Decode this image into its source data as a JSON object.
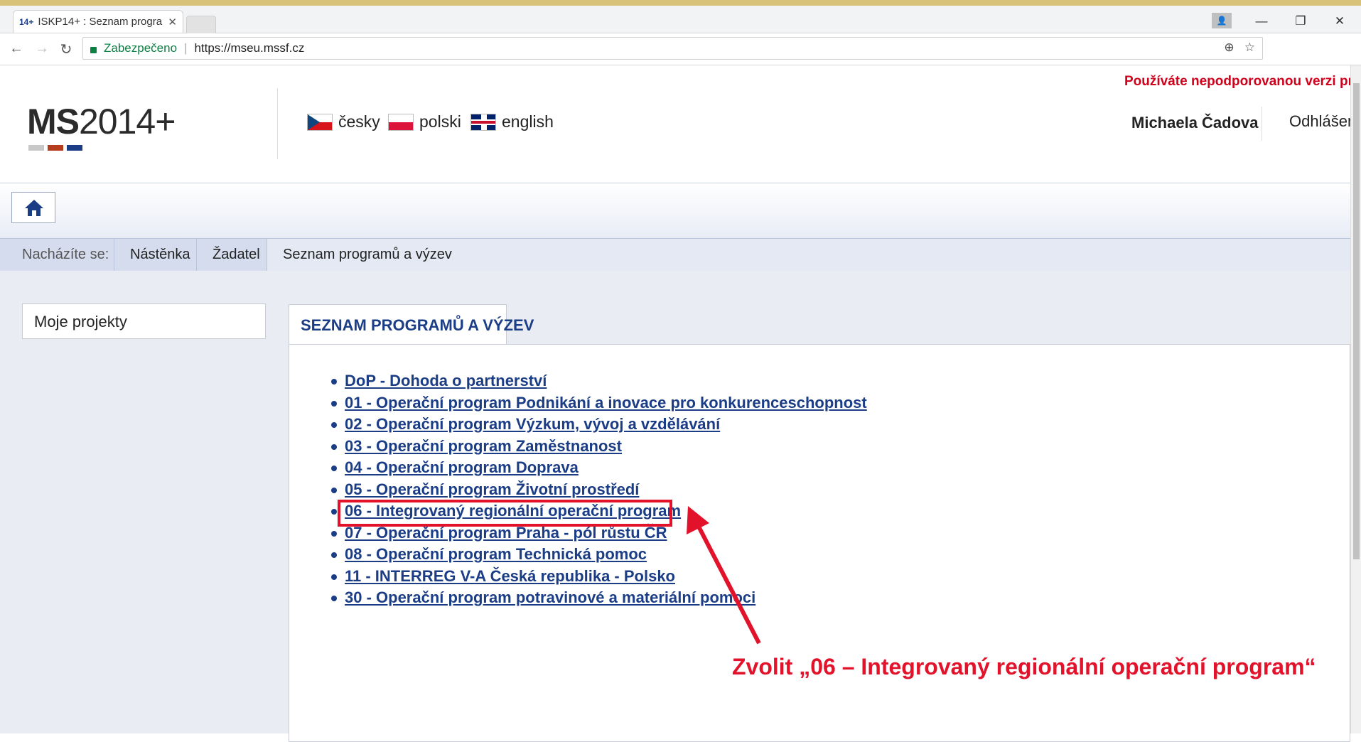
{
  "browser": {
    "tab_title": "ISKP14+ : Seznam progra",
    "tab_favicon": "14+",
    "secure_label": "Zabezpečeno",
    "url": "https://mseu.mssf.cz"
  },
  "header": {
    "logo_bold": "MS",
    "logo_rest": "2014+",
    "languages": [
      {
        "label": "česky",
        "flag": "cz-flag-icon"
      },
      {
        "label": "polski",
        "flag": "pl-flag-icon"
      },
      {
        "label": "english",
        "flag": "uk-flag-icon"
      }
    ],
    "warning": "Používáte nepodporovanou verzi prohlí",
    "user_name": "Michaela Čadova",
    "logout": "Odhlášen"
  },
  "breadcrumb": {
    "label": "Nacházíte se:",
    "items": [
      "Nástěnka",
      "Žadatel",
      "Seznam programů a výzev"
    ]
  },
  "sidebar": {
    "items": [
      {
        "label": "Moje projekty"
      }
    ]
  },
  "panel": {
    "tab_title": "SEZNAM PROGRAMŮ A VÝZEV",
    "programs": [
      "DoP - Dohoda o partnerství",
      "01 - Operační program Podnikání a inovace pro konkurenceschopnost",
      "02 - Operační program Výzkum, vývoj a vzdělávání",
      "03 - Operační program Zaměstnanost",
      "04 - Operační program Doprava",
      "05 - Operační program Životní prostředí",
      "06 - Integrovaný regionální operační program",
      "07 - Operační program Praha - pól růstu ČR",
      "08 - Operační program Technická pomoc",
      "11 - INTERREG V-A Česká republika - Polsko",
      "30 - Operační program potravinové a materiální pomoci"
    ]
  },
  "annotation": {
    "instruction": "Zvolit „06 – Integrovaný regionální operační program“",
    "color": "#e3122b"
  },
  "colors": {
    "accent_blue": "#1b3d86",
    "secure_green": "#0b8043",
    "warning_red": "#d0021b"
  }
}
